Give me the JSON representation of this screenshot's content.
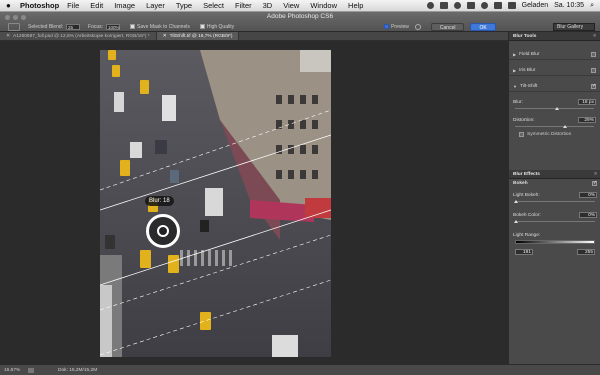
{
  "menubar": {
    "app_name": "Photoshop",
    "items": [
      "File",
      "Edit",
      "Image",
      "Layer",
      "Type",
      "Select",
      "Filter",
      "3D",
      "View",
      "Window",
      "Help"
    ],
    "user": "Geladen",
    "clock": "Sa. 10:35"
  },
  "window": {
    "title": "Adobe Photoshop CS6"
  },
  "options": {
    "selected_blend_label": "Selected Blend:",
    "selected_blend_value": "25",
    "focus_label": "Focus:",
    "focus_value": "100%",
    "save_mask_label": "Save Mask to Channels",
    "high_quality_label": "High Quality",
    "preview_label": "Preview",
    "cancel_label": "Cancel",
    "ok_label": "OK",
    "gallery_value": "Blur Gallery"
  },
  "tabs": [
    {
      "label": "A1260687_full.psd @ 12,5% (Arbeitskopie korrigiert, RGB/16*) *",
      "active": false
    },
    {
      "label": "TiltShift.tif @ 16,7% (RGB/8*)",
      "active": true
    }
  ],
  "canvas": {
    "blur_pin_label": "Blur: 18"
  },
  "status": {
    "zoom": "16,67%",
    "doc": "Dok: 15,2M/15,2M"
  },
  "panel": {
    "blur_tools_title": "Blur Tools",
    "items": [
      {
        "label": "Field Blur",
        "checked": false
      },
      {
        "label": "Iris Blur",
        "checked": false
      },
      {
        "label": "Tilt-Shift",
        "checked": true
      }
    ],
    "blur_label": "Blur:",
    "blur_value": "18 px",
    "distortion_label": "Distortion:",
    "distortion_value": "29%",
    "symmetric_label": "Symmetric Distortion",
    "effects_title": "Blur Effects",
    "bokeh_label": "Bokeh",
    "light_bokeh_label": "Light Bokeh:",
    "light_bokeh_value": "0%",
    "bokeh_color_label": "Bokeh Color:",
    "bokeh_color_value": "0%",
    "light_range_label": "Light Range:",
    "light_range_min": "191",
    "light_range_max": "255"
  }
}
